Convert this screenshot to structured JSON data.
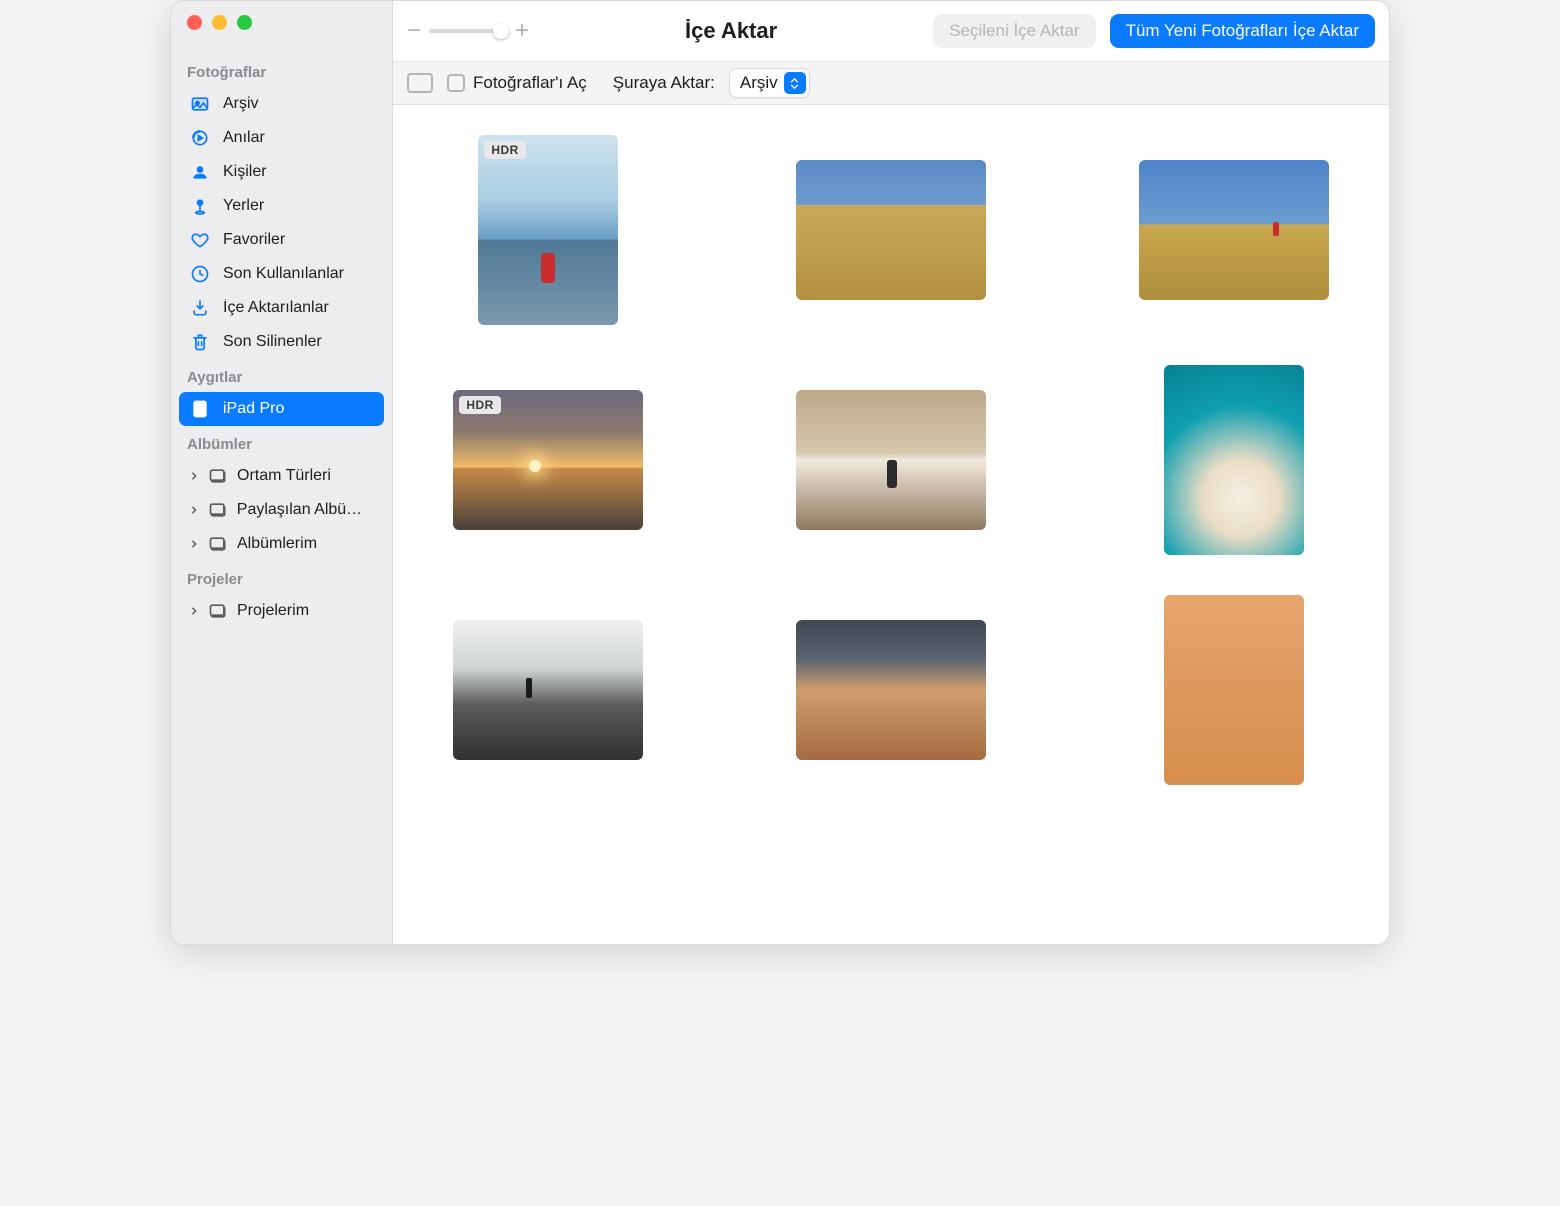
{
  "toolbar": {
    "zoom_minus": "−",
    "zoom_plus": "+",
    "title": "İçe Aktar",
    "import_selected": "Seçileni İçe Aktar",
    "import_all": "Tüm Yeni Fotoğrafları İçe Aktar"
  },
  "options": {
    "open_photos_label": "Fotoğraflar'ı Aç",
    "import_to_label": "Şuraya Aktar:",
    "import_to_value": "Arşiv"
  },
  "sidebar": {
    "photos_section": "Fotoğraflar",
    "library": "Arşiv",
    "memories": "Anılar",
    "people": "Kişiler",
    "places": "Yerler",
    "favorites": "Favoriler",
    "recents": "Son Kullanılanlar",
    "imports": "İçe Aktarılanlar",
    "trash": "Son Silinenler",
    "devices_section": "Aygıtlar",
    "ipad": "iPad Pro",
    "albums_section": "Albümler",
    "media_types": "Ortam Türleri",
    "shared_albums": "Paylaşılan Albümler",
    "my_albums": "Albümlerim",
    "projects_section": "Projeler",
    "my_projects": "Projelerim"
  },
  "badges": {
    "hdr": "HDR"
  },
  "photos": [
    {
      "orientation": "portrait",
      "scene": "scene-lake",
      "hdr": true,
      "figure": "scene-figure-red",
      "desc": "lake-mountain-red-jacket"
    },
    {
      "orientation": "landscape",
      "scene": "scene-grass-hill",
      "hdr": false,
      "figure": null,
      "desc": "golden-grassy-hill"
    },
    {
      "orientation": "landscape",
      "scene": "scene-field-person",
      "hdr": false,
      "figure": "scene-figure-small",
      "desc": "field-distant-red-figure"
    },
    {
      "orientation": "landscape",
      "scene": "scene-sunset",
      "hdr": true,
      "figure": "sun-dot",
      "desc": "beach-sunset"
    },
    {
      "orientation": "landscape",
      "scene": "scene-beach-run",
      "hdr": false,
      "figure": "scene-figure-dark",
      "desc": "person-running-wet-beach"
    },
    {
      "orientation": "portrait",
      "scene": "scene-dog",
      "hdr": false,
      "figure": null,
      "desc": "white-dog-teal-bg"
    },
    {
      "orientation": "landscape",
      "scene": "scene-rocks",
      "hdr": false,
      "figure": "scene-figure-standing",
      "desc": "rocky-beach-silhouette"
    },
    {
      "orientation": "landscape",
      "scene": "scene-canyon",
      "hdr": false,
      "figure": null,
      "desc": "striped-rock-formation"
    },
    {
      "orientation": "portrait",
      "scene": "scene-sand",
      "hdr": false,
      "figure": null,
      "desc": "hands-pouring-sand"
    }
  ]
}
